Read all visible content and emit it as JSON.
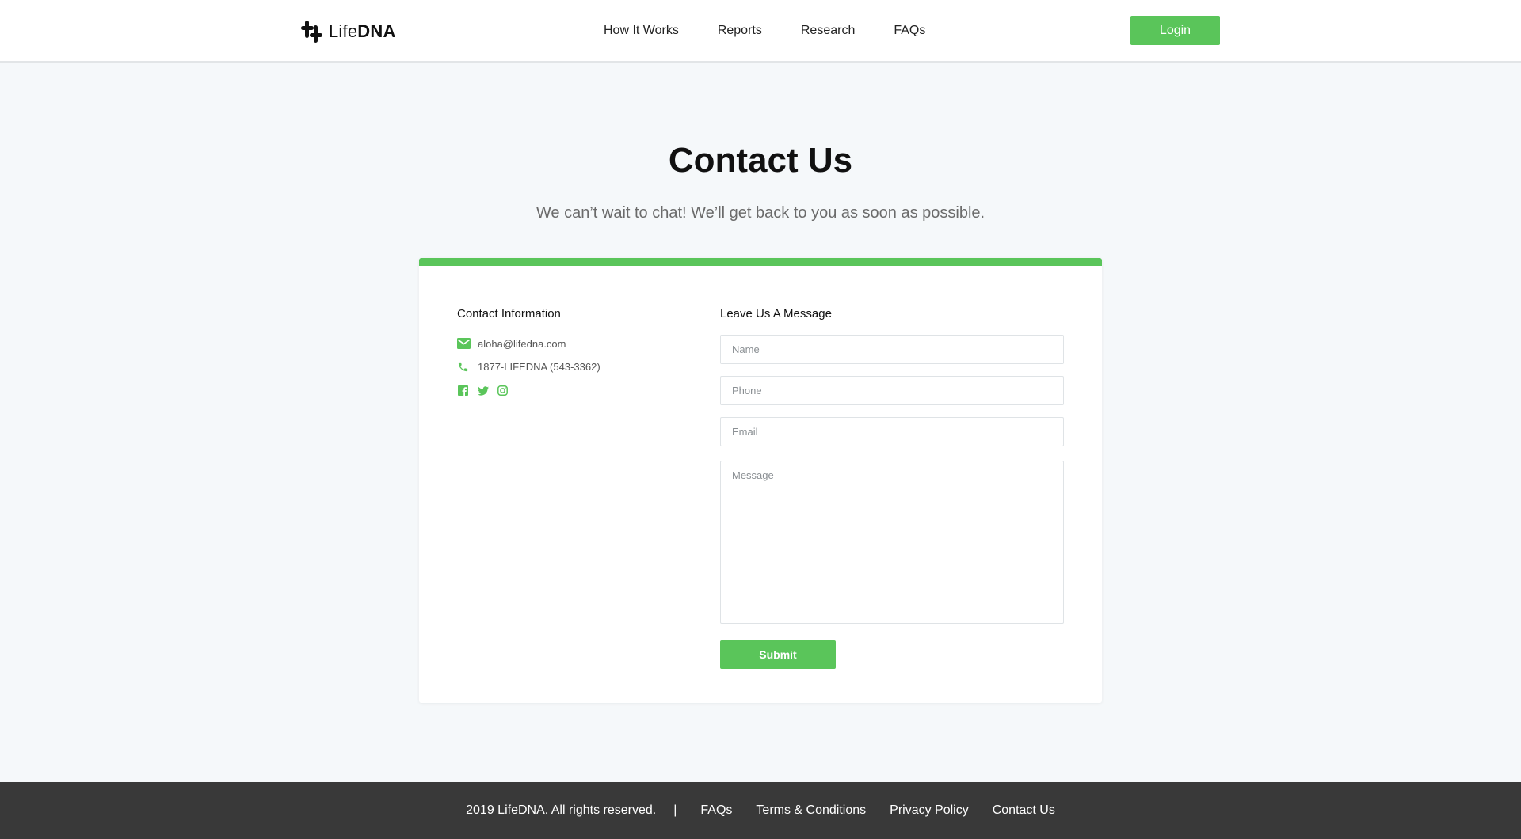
{
  "brand": {
    "name_light": "Life",
    "name_bold": "DNA",
    "accent_color": "#5ac55a"
  },
  "nav": {
    "items": [
      {
        "label": "How It Works"
      },
      {
        "label": "Reports"
      },
      {
        "label": "Research"
      },
      {
        "label": "FAQs"
      }
    ],
    "login_label": "Login"
  },
  "hero": {
    "title": "Contact Us",
    "subtitle": "We can’t wait to chat! We’ll get back to you as soon as possible."
  },
  "contact_info": {
    "title": "Contact Information",
    "email": "aloha@lifedna.com",
    "phone": "1877-LIFEDNA (543-3362)",
    "social_icons": [
      "facebook-icon",
      "twitter-icon",
      "instagram-icon"
    ]
  },
  "message_form": {
    "title": "Leave Us A Message",
    "name_placeholder": "Name",
    "phone_placeholder": "Phone",
    "email_placeholder": "Email",
    "message_placeholder": "Message",
    "submit_label": "Submit"
  },
  "footer": {
    "copyright": "2019 LifeDNA. All rights reserved.",
    "separator": "|",
    "links": [
      "FAQs",
      "Terms & Conditions",
      "Privacy Policy",
      "Contact Us"
    ]
  }
}
